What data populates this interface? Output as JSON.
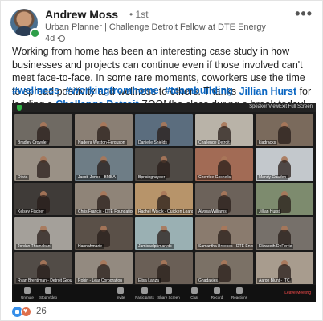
{
  "post": {
    "author": {
      "name": "Andrew Moss",
      "degree": "• 1st",
      "headline": "Urban Planner | Challenge Detroit Fellow at DTE Energy",
      "time": "4d •"
    },
    "more_icon": "more-options-icon",
    "text_part1": "Working from home has been an interesting case study in how businesses and projects can continue even if those involved can't meet face-to-face. In some rare moments, coworkers use the time to spread positivity and wellness to others. Thanks ",
    "mention1": "Jillian Hurst",
    "text_part2": " for leading a ",
    "mention2": "Challenge Detroit",
    "text_part3": " ZOOMba class during a break today!",
    "hashtags": [
      "#wellness",
      "#workingfromhome",
      "#teambuilding"
    ],
    "reactions": {
      "icons": [
        "like-icon",
        "love-icon"
      ],
      "count": "26"
    }
  },
  "zoom": {
    "view_label": "Speaker View",
    "exit_label": "Exit Full Screen",
    "tiles": [
      {
        "name": "Bradley Crowder",
        "bg": "#6f6a63"
      },
      {
        "name": "Nadeira Weston-Ferguson",
        "bg": "#8a7f74"
      },
      {
        "name": "Danielle Shields",
        "bg": "#5b6d7e"
      },
      {
        "name": "Challenge Detroit",
        "bg": "#b9b3a8"
      },
      {
        "name": "kiadracks",
        "bg": "#7a6a5c"
      },
      {
        "name": "Dilvia",
        "bg": "#9a9186"
      },
      {
        "name": "Jacob Jones - BMBA",
        "bg": "#6e7d86"
      },
      {
        "name": "Bprisinghayder",
        "bg": "#4f4a45"
      },
      {
        "name": "Cherrlee Gosnells",
        "bg": "#a26b55"
      },
      {
        "name": "Mandy Guaden",
        "bg": "#c3c8cc"
      },
      {
        "name": "Kelsey Fischer",
        "bg": "#3f3b38"
      },
      {
        "name": "Chris Francis - DTE Foundation",
        "bg": "#8f8478"
      },
      {
        "name": "Rachel Wojcik - Quicken Loans",
        "bg": "#b7946a"
      },
      {
        "name": "Alyssa Williams",
        "bg": "#6c625a"
      },
      {
        "name": "Jillian Hurst",
        "bg": "#7d8b6e"
      },
      {
        "name": "Jordan Thomaban",
        "bg": "#a4a09a"
      },
      {
        "name": "Hannahmarie",
        "bg": "#5a5048"
      },
      {
        "name": "Jamicaelprimarydc",
        "bg": "#9ab0b3"
      },
      {
        "name": "Samantha Brookes - DTE Energy",
        "bg": "#8a7b6e"
      },
      {
        "name": "Elizabeth DeFerrie",
        "bg": "#76706a"
      },
      {
        "name": "Ryan Brentiman - Detroit Group",
        "bg": "#524c47"
      },
      {
        "name": "Robin - Lear Corporation",
        "bg": "#938a80"
      },
      {
        "name": "Elisa Lanza",
        "bg": "#6a5f56"
      },
      {
        "name": "Ghadakies",
        "bg": "#7b7166"
      },
      {
        "name": "Aaron Blunt - ITC",
        "bg": "#a89c8e"
      }
    ],
    "controls": [
      "Unmute",
      "Stop Video",
      "Invite",
      "Participants",
      "Share Screen",
      "Chat",
      "Record",
      "Reactions"
    ],
    "end_label": "Leave Meeting"
  }
}
